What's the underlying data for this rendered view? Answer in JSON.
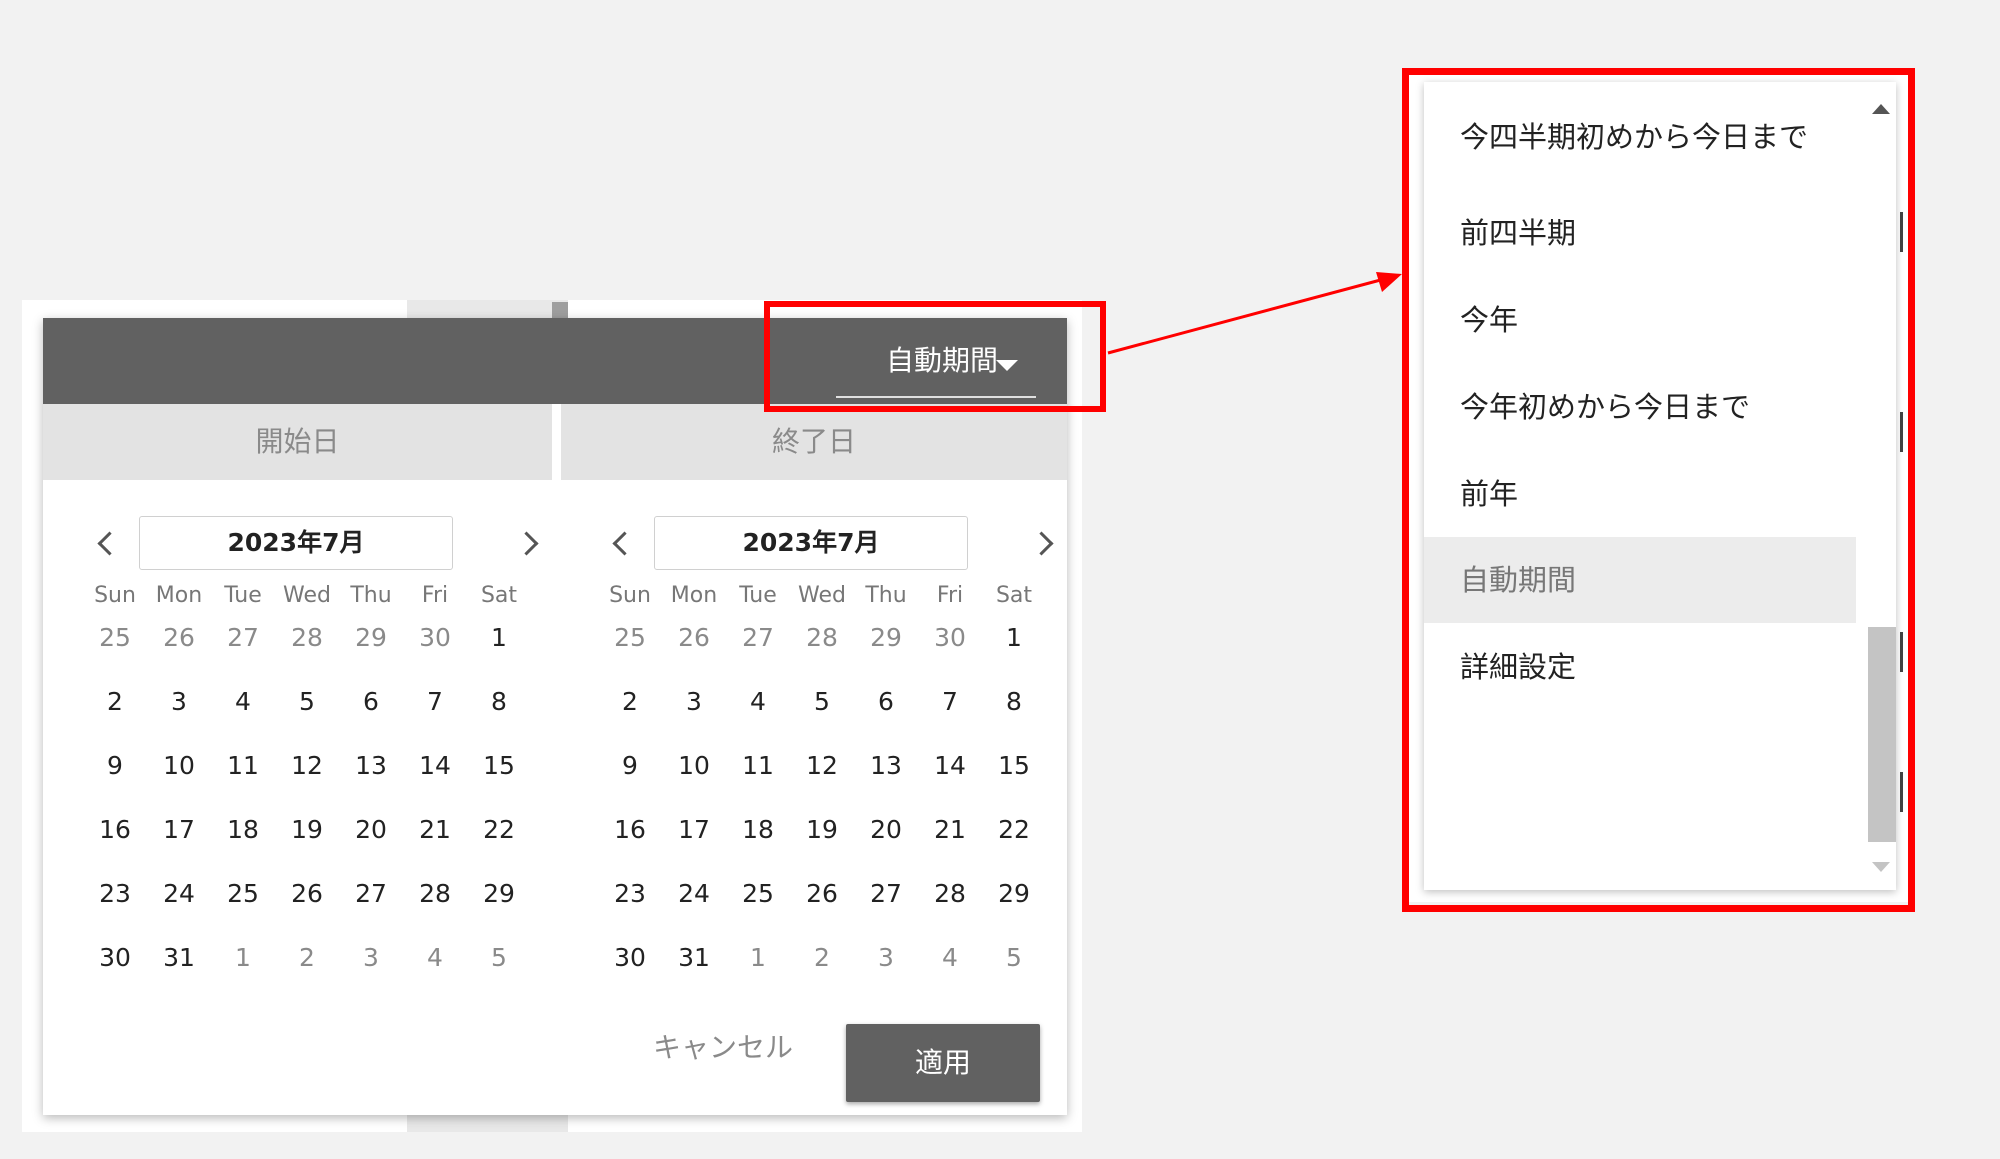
{
  "header": {
    "period_label": "自動期間"
  },
  "columns": {
    "start_label": "開始日",
    "end_label": "終了日"
  },
  "start_month": {
    "title": "2023年7月",
    "weekdays": [
      "Sun",
      "Mon",
      "Tue",
      "Wed",
      "Thu",
      "Fri",
      "Sat"
    ],
    "weeks": [
      [
        "25",
        "26",
        "27",
        "28",
        "29",
        "30",
        "1"
      ],
      [
        "2",
        "3",
        "4",
        "5",
        "6",
        "7",
        "8"
      ],
      [
        "9",
        "10",
        "11",
        "12",
        "13",
        "14",
        "15"
      ],
      [
        "16",
        "17",
        "18",
        "19",
        "20",
        "21",
        "22"
      ],
      [
        "23",
        "24",
        "25",
        "26",
        "27",
        "28",
        "29"
      ],
      [
        "30",
        "31",
        "1",
        "2",
        "3",
        "4",
        "5"
      ]
    ]
  },
  "end_month": {
    "title": "2023年7月",
    "weekdays": [
      "Sun",
      "Mon",
      "Tue",
      "Wed",
      "Thu",
      "Fri",
      "Sat"
    ],
    "weeks": [
      [
        "25",
        "26",
        "27",
        "28",
        "29",
        "30",
        "1"
      ],
      [
        "2",
        "3",
        "4",
        "5",
        "6",
        "7",
        "8"
      ],
      [
        "9",
        "10",
        "11",
        "12",
        "13",
        "14",
        "15"
      ],
      [
        "16",
        "17",
        "18",
        "19",
        "20",
        "21",
        "22"
      ],
      [
        "23",
        "24",
        "25",
        "26",
        "27",
        "28",
        "29"
      ],
      [
        "30",
        "31",
        "1",
        "2",
        "3",
        "4",
        "5"
      ]
    ]
  },
  "actions": {
    "cancel_label": "キャンセル",
    "apply_label": "適用"
  },
  "dropdown": {
    "items": [
      {
        "label": "今四半期初めから今日まで",
        "selected": false
      },
      {
        "label": "前四半期",
        "selected": false
      },
      {
        "label": "今年",
        "selected": false
      },
      {
        "label": "今年初めから今日まで",
        "selected": false
      },
      {
        "label": "前年",
        "selected": false
      },
      {
        "label": "自動期間",
        "selected": true
      },
      {
        "label": "詳細設定",
        "selected": false
      }
    ]
  },
  "colors": {
    "header_bg": "#616161",
    "highlight": "#ff0000",
    "selected_bg": "#ececec"
  }
}
